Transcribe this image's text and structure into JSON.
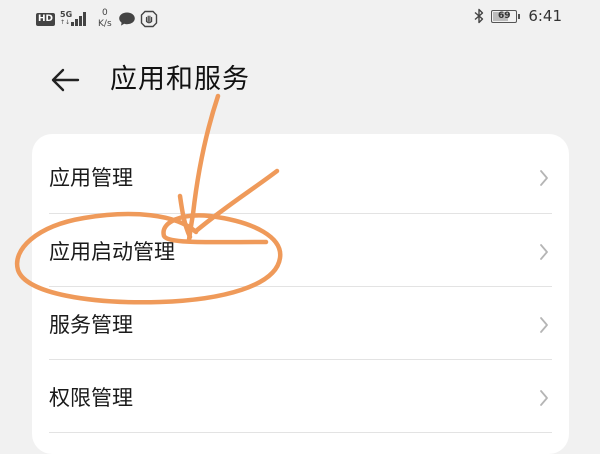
{
  "status_bar": {
    "hd_label": "HD",
    "network_label": "5G",
    "net_activity": "↑↓",
    "speed_value": "0",
    "speed_unit": "K/s",
    "battery_level": "69",
    "time": "6:41"
  },
  "header": {
    "title": "应用和服务"
  },
  "settings_list": {
    "items": [
      {
        "label": "应用管理"
      },
      {
        "label": "应用启动管理"
      },
      {
        "label": "服务管理"
      },
      {
        "label": "权限管理"
      }
    ]
  },
  "colors": {
    "annotation_stroke": "#ef9a5a",
    "card_background": "#ffffff",
    "page_background": "#f1f1f1"
  }
}
